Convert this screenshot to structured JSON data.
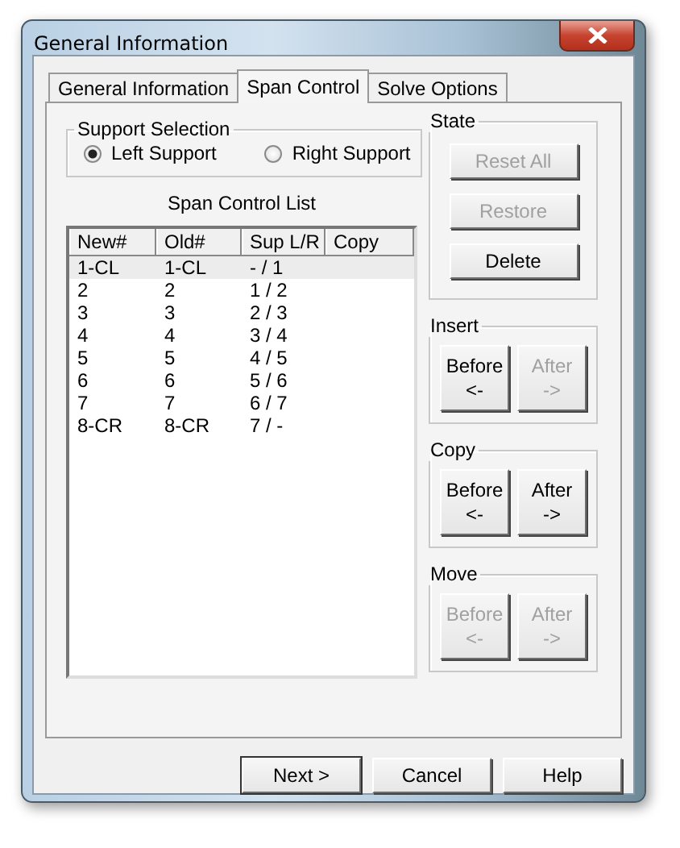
{
  "window": {
    "title": "General Information"
  },
  "tabs": [
    {
      "label": "General Information",
      "selected": false
    },
    {
      "label": "Span Control",
      "selected": true
    },
    {
      "label": "Solve Options",
      "selected": false
    }
  ],
  "support_selection": {
    "title": "Support Selection",
    "options": [
      {
        "label": "Left Support",
        "selected": true
      },
      {
        "label": "Right Support",
        "selected": false
      }
    ]
  },
  "span_list": {
    "title": "Span Control List",
    "columns": [
      "New#",
      "Old#",
      "Sup L/R",
      "Copy"
    ],
    "rows": [
      {
        "cells": [
          "1-CL",
          "1-CL",
          "- / 1"
        ],
        "selected": true
      },
      {
        "cells": [
          "2",
          "2",
          "1 / 2"
        ],
        "selected": false
      },
      {
        "cells": [
          "3",
          "3",
          "2 / 3"
        ],
        "selected": false
      },
      {
        "cells": [
          "4",
          "4",
          "3 / 4"
        ],
        "selected": false
      },
      {
        "cells": [
          "5",
          "5",
          "4 / 5"
        ],
        "selected": false
      },
      {
        "cells": [
          "6",
          "6",
          "5 / 6"
        ],
        "selected": false
      },
      {
        "cells": [
          "7",
          "7",
          "6 / 7"
        ],
        "selected": false
      },
      {
        "cells": [
          "8-CR",
          "8-CR",
          "7 / -"
        ],
        "selected": false
      }
    ]
  },
  "groups": [
    {
      "title": "State",
      "kind": "column",
      "buttons": [
        {
          "label": "Reset All",
          "disabled": true
        },
        {
          "label": "Restore",
          "disabled": true
        },
        {
          "label": "Delete",
          "disabled": false
        }
      ]
    },
    {
      "title": "Insert",
      "kind": "pair",
      "buttons": [
        {
          "label": "Before",
          "arrow": "<-",
          "disabled": false
        },
        {
          "label": "After",
          "arrow": "->",
          "disabled": true
        }
      ]
    },
    {
      "title": "Copy",
      "kind": "pair",
      "buttons": [
        {
          "label": "Before",
          "arrow": "<-",
          "disabled": false
        },
        {
          "label": "After",
          "arrow": "->",
          "disabled": false
        }
      ]
    },
    {
      "title": "Move",
      "kind": "pair",
      "buttons": [
        {
          "label": "Before",
          "arrow": "<-",
          "disabled": true
        },
        {
          "label": "After",
          "arrow": "->",
          "disabled": true
        }
      ]
    }
  ],
  "footer_buttons": [
    "Next >",
    "Cancel",
    "Help"
  ]
}
